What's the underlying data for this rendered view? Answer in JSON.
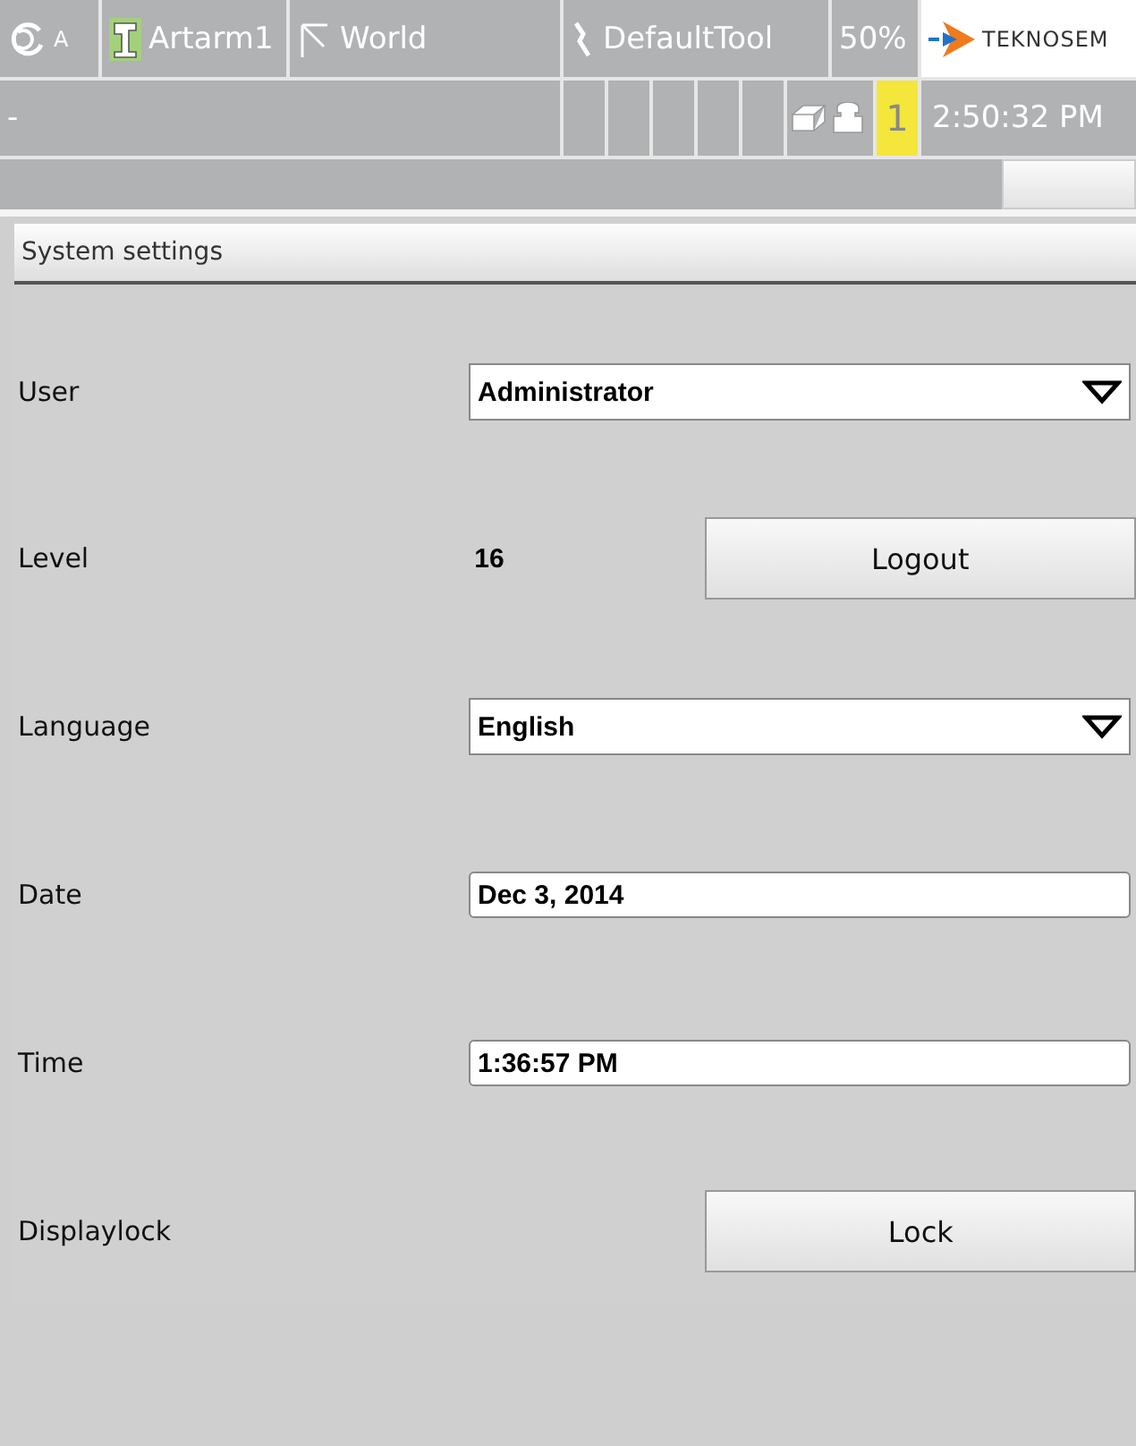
{
  "top_bar": {
    "mode": "A",
    "robot": "Artarm1",
    "frame": "World",
    "tool": "DefaultTool",
    "speed": "50%",
    "logo": "TEKNOSEM"
  },
  "status_bar": {
    "message": "-",
    "task_number": "1",
    "clock": "2:50:32 PM"
  },
  "panel": {
    "title": "System settings",
    "rows": [
      {
        "kind": "dropdown",
        "label": "User",
        "value": "Administrator"
      },
      {
        "kind": "value_button",
        "label": "Level",
        "value": "16",
        "button": "Logout"
      },
      {
        "kind": "dropdown",
        "label": "Language",
        "value": "English"
      },
      {
        "kind": "field",
        "label": "Date",
        "value": "Dec 3, 2014"
      },
      {
        "kind": "field",
        "label": "Time",
        "value": "1:36:57 PM"
      },
      {
        "kind": "button",
        "label": "Displaylock",
        "button": "Lock"
      }
    ]
  }
}
